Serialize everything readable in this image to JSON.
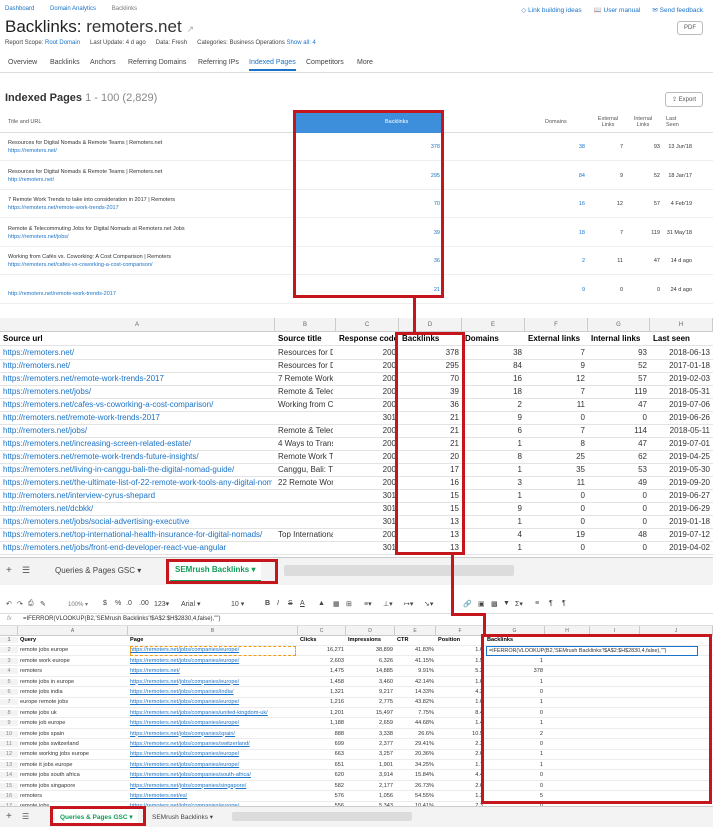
{
  "breadcrumb": [
    "Dashboard",
    "Domain Analytics",
    "Backlinks"
  ],
  "top_links": [
    "Link building ideas",
    "User manual",
    "Send feedback"
  ],
  "title_prefix": "Backlinks:",
  "domain": "remoters.net",
  "pdf": "PDF",
  "meta": [
    "Report Scope:",
    "Root Domain",
    "Last Update: 4 d ago",
    "Data: Fresh",
    "Categories: Business Operations",
    "Show all: 4"
  ],
  "tabs": [
    "Overview",
    "Backlinks",
    "Anchors",
    "Referring Domains",
    "Referring IPs",
    "Indexed Pages",
    "Competitors",
    "More"
  ],
  "indexed_title": "Indexed Pages",
  "indexed_range": "1 - 100 (2,829)",
  "export": "Export",
  "sem_cols": [
    "Title and URL",
    "Backlinks",
    "Domains",
    "External Links",
    "Internal Links",
    "Last Seen"
  ],
  "sem_rows": [
    [
      "Resources for Digital Nomads & Remote Teams | Remoters.net",
      "https://remoters.net/",
      "378",
      "38",
      "7",
      "93",
      "13 Jun'18"
    ],
    [
      "Resources for Digital Nomads & Remote Teams | Remoters.net",
      "http://remoters.net/",
      "295",
      "84",
      "9",
      "52",
      "18 Jan'17"
    ],
    [
      "7 Remote Work Trends to take into consideration in 2017 | Remoters",
      "https://remoters.net/remote-work-trends-2017",
      "70",
      "16",
      "12",
      "57",
      "4 Feb'19"
    ],
    [
      "Remote & Telecommuting Jobs for Digital Nomads at Remoters.net Jobs",
      "https://remoters.net/jobs/",
      "39",
      "18",
      "7",
      "119",
      "31 May'18"
    ],
    [
      "Working from Cafés vs. Coworking: A Cost Comparison | Remoters",
      "https://remoters.net/cafes-vs-coworking-a-cost-comparison/",
      "36",
      "2",
      "11",
      "47",
      "14 d ago"
    ],
    [
      "",
      "http://remoters.net/remote-work-trends-2017",
      "21",
      "9",
      "0",
      "0",
      "24 d ago"
    ]
  ],
  "ss1_cols": [
    "A",
    "B",
    "C",
    "D",
    "E",
    "F",
    "G",
    "H"
  ],
  "ss1_header": [
    "Source url",
    "Source title",
    "Response code",
    "Backlinks",
    "Domains",
    "External links",
    "Internal links",
    "Last seen"
  ],
  "ss1_rows": [
    [
      "https://remoters.net/",
      "Resources for Di",
      "200",
      "378",
      "38",
      "7",
      "93",
      "2018-06-13"
    ],
    [
      "http://remoters.net/",
      "Resources for Di",
      "200",
      "295",
      "84",
      "9",
      "52",
      "2017-01-18"
    ],
    [
      "https://remoters.net/remote-work-trends-2017",
      "7 Remote Work T",
      "200",
      "70",
      "16",
      "12",
      "57",
      "2019-02-03"
    ],
    [
      "https://remoters.net/jobs/",
      "Remote & Teleco",
      "200",
      "39",
      "18",
      "7",
      "119",
      "2018-05-31"
    ],
    [
      "https://remoters.net/cafes-vs-coworking-a-cost-comparison/",
      "Working from Ca",
      "200",
      "36",
      "2",
      "11",
      "47",
      "2019-07-06"
    ],
    [
      "http://remoters.net/remote-work-trends-2017",
      "",
      "301",
      "21",
      "9",
      "0",
      "0",
      "2019-06-26"
    ],
    [
      "http://remoters.net/jobs/",
      "Remote & Teleco",
      "200",
      "21",
      "6",
      "7",
      "114",
      "2018-05-11"
    ],
    [
      "https://remoters.net/increasing-screen-related-estate/",
      "4 Ways to Transit",
      "200",
      "21",
      "1",
      "8",
      "47",
      "2019-07-01"
    ],
    [
      "https://remoters.net/remote-work-trends-future-insights/",
      "Remote Work Tre",
      "200",
      "20",
      "8",
      "25",
      "62",
      "2019-04-25"
    ],
    [
      "https://remoters.net/living-in-canggu-bali-the-digital-nomad-guide/",
      "Canggu, Bali: The",
      "200",
      "17",
      "1",
      "35",
      "53",
      "2019-05-30"
    ],
    [
      "https://remoters.net/the-ultimate-list-of-22-remote-work-tools-any-digital-noma",
      "22 Remote Work",
      "200",
      "16",
      "3",
      "11",
      "49",
      "2019-09-20"
    ],
    [
      "http://remoters.net/interview-cyrus-shepard",
      "",
      "301",
      "15",
      "1",
      "0",
      "0",
      "2019-06-27"
    ],
    [
      "http://remoters.net/dcbkk/",
      "",
      "301",
      "15",
      "9",
      "0",
      "0",
      "2019-06-29"
    ],
    [
      "https://remoters.net/jobs/social-advertising-executive",
      "",
      "301",
      "13",
      "1",
      "0",
      "0",
      "2019-01-18"
    ],
    [
      "https://remoters.net/top-international-health-insurance-for-digital-nomads/",
      "Top International",
      "200",
      "13",
      "4",
      "19",
      "48",
      "2019-07-12"
    ],
    [
      "https://remoters.net/jobs/front-end-developer-react-vue-angular",
      "",
      "301",
      "13",
      "1",
      "0",
      "0",
      "2019-04-02"
    ]
  ],
  "ss1_tabs": [
    "Queries & Pages GSC",
    "SEMrush Backlinks"
  ],
  "toolbar2": {
    "zoom": "100%",
    "font": "Arial",
    "size": "10",
    "fx": "fx"
  },
  "formula": "=IFERROR(VLOOKUP(B2,'SEMrush Backlinks'!$A$2:$H$2830,4,false),\"\")",
  "ss2_cols": [
    "A",
    "B",
    "C",
    "D",
    "E",
    "F",
    "G",
    "H",
    "I",
    "J",
    "K"
  ],
  "ss2_header": [
    "Query",
    "Page",
    "Clicks",
    "Impressions",
    "CTR",
    "Position",
    "Backlinks"
  ],
  "ss2_rows": [
    [
      "remote jobs europe",
      "https://remoters.net/jobs/companies/europe/",
      "16,271",
      "38,899",
      "41.83%",
      "1.6",
      ""
    ],
    [
      "remote work europe",
      "https://remoters.net/jobs/companies/europe/",
      "2,603",
      "6,326",
      "41.15%",
      "1.5",
      "1"
    ],
    [
      "remoters",
      "https://remoters.net/",
      "1,475",
      "14,885",
      "9.91%",
      "5.3",
      "378"
    ],
    [
      "remote jobs in europe",
      "https://remoters.net/jobs/companies/europe/",
      "1,458",
      "3,460",
      "42.14%",
      "1.6",
      "1"
    ],
    [
      "remote jobs india",
      "https://remoters.net/jobs/companies/india/",
      "1,321",
      "9,217",
      "14.33%",
      "4.3",
      "0"
    ],
    [
      "europe remote jobs",
      "https://remoters.net/jobs/companies/europe/",
      "1,216",
      "2,775",
      "43.82%",
      "1.6",
      "1"
    ],
    [
      "remote jobs uk",
      "https://remoters.net/jobs/companies/united-kingdom-uk/",
      "1,201",
      "15,497",
      "7.75%",
      "8.4",
      "0"
    ],
    [
      "remote job europe",
      "https://remoters.net/jobs/companies/europe/",
      "1,188",
      "2,659",
      "44.68%",
      "1.4",
      "1"
    ],
    [
      "remote jobs spain",
      "https://remoters.net/jobs/companies/spain/",
      "888",
      "3,338",
      "26.6%",
      "10.5",
      "2"
    ],
    [
      "remote jobs switzerland",
      "https://remoters.net/jobs/companies/switzerland/",
      "699",
      "2,377",
      "29.41%",
      "2.3",
      "0"
    ],
    [
      "remote working jobs europe",
      "https://remoters.net/jobs/companies/europe/",
      "663",
      "3,257",
      "20.36%",
      "2.6",
      "1"
    ],
    [
      "remote it jobs europe",
      "https://remoters.net/jobs/companies/europe/",
      "651",
      "1,901",
      "34.25%",
      "1.7",
      "1"
    ],
    [
      "remote jobs south africa",
      "https://remoters.net/jobs/companies/south-africa/",
      "620",
      "3,914",
      "15.84%",
      "4.4",
      "0"
    ],
    [
      "remote jobs singapore",
      "https://remoters.net/jobs/companies/singapore/",
      "582",
      "2,177",
      "26.73%",
      "2.6",
      "0"
    ],
    [
      "remoters",
      "https://remoters.net/es/",
      "576",
      "1,056",
      "54.55%",
      "1.3",
      "5"
    ],
    [
      "remote jobs",
      "https://remoters.net/jobs/companies/europe/",
      "556",
      "5,343",
      "10.41%",
      "7.3",
      "0"
    ]
  ],
  "ss2_tabs": [
    "Queries & Pages GSC",
    "SEMrush Backlinks"
  ],
  "colors": {
    "accent": "#1a73c8",
    "highlight": "#c4161c",
    "green_tab": "#0f9d58"
  }
}
